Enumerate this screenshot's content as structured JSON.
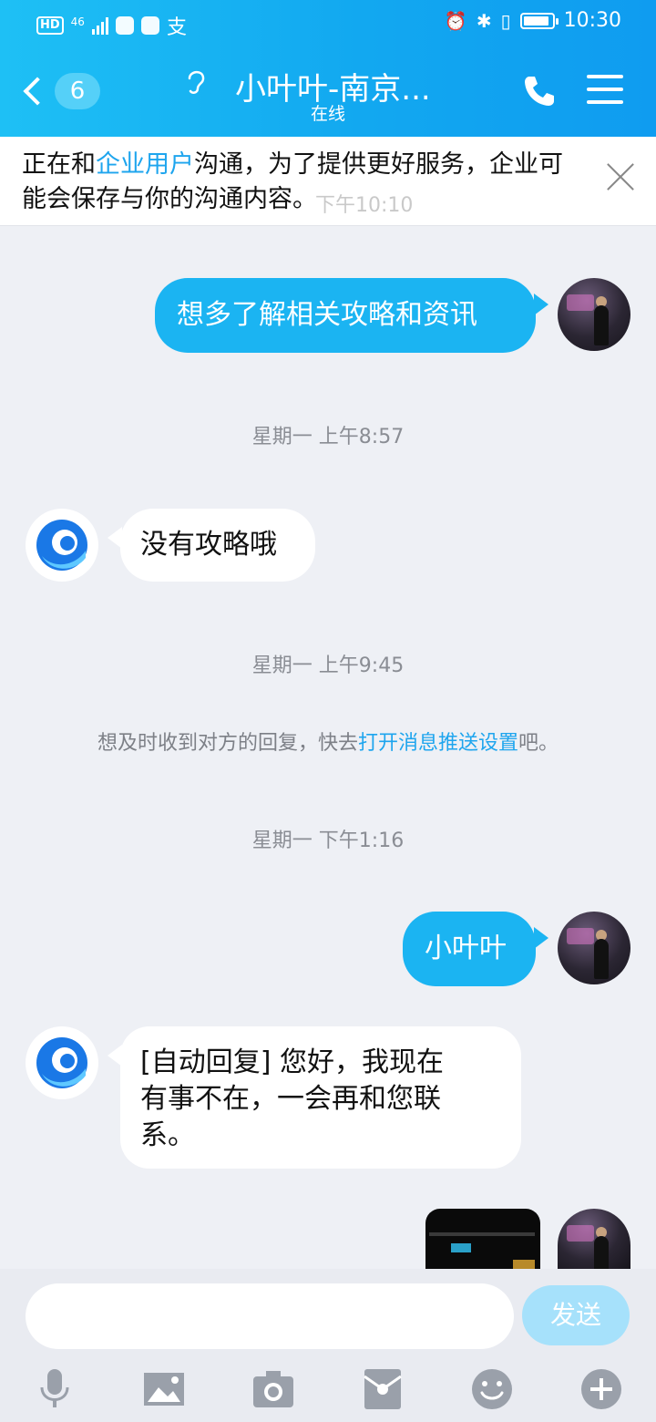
{
  "status_bar": {
    "hd": "HD",
    "network": "46",
    "alipay": "支",
    "time": "10:30",
    "battery_level": 0.9
  },
  "header": {
    "unread_count": "6",
    "title": "小叶叶-南京...",
    "subtitle": "在线"
  },
  "notice": {
    "text_before": "正在和",
    "link": "企业用户",
    "text_after": "沟通，为了提供更好服务，企业可能会保存与你的沟通内容。",
    "faded_time": "下午10:10"
  },
  "messages": [
    {
      "from": "me",
      "text": "想多了解相关攻略和资讯"
    },
    {
      "type": "time",
      "text": "星期一 上午8:57"
    },
    {
      "from": "them",
      "text": "没有攻略哦"
    },
    {
      "type": "time",
      "text": "星期一 上午9:45"
    },
    {
      "type": "tip",
      "text_before": "想及时收到对方的回复，快去",
      "link": "打开消息推送设置",
      "text_after": "吧。"
    },
    {
      "type": "time",
      "text": "星期一 下午1:16"
    },
    {
      "from": "me",
      "text": "小叶叶"
    },
    {
      "from": "them",
      "lines": [
        "[自动回复] 您好，我现在",
        "有事不在，一会再和您联",
        "系。"
      ]
    },
    {
      "from": "me",
      "type": "image"
    }
  ],
  "input": {
    "value": "",
    "placeholder": "",
    "send_label": "发送"
  },
  "toolbar": {
    "icons": [
      "microphone-icon",
      "image-icon",
      "camera-icon",
      "red-packet-icon",
      "emoji-icon",
      "plus-icon"
    ]
  },
  "colors": {
    "header": "#12a8f0",
    "my_bubble": "#1bb4f2",
    "link": "#1ea5ee",
    "send_disabled": "#a6e1fb"
  }
}
